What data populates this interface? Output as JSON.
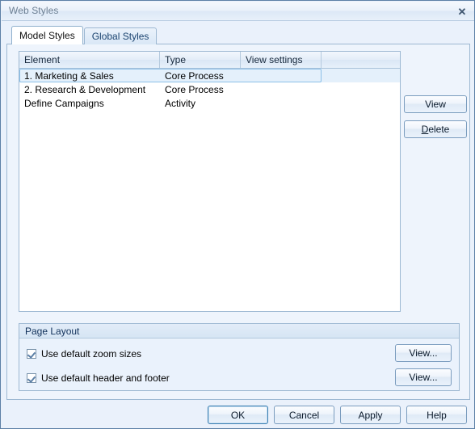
{
  "window": {
    "title": "Web Styles",
    "close_icon": "close-icon",
    "close_glyph": "✕"
  },
  "tabs": [
    {
      "label": "Model Styles",
      "active": true
    },
    {
      "label": "Global Styles",
      "active": false
    }
  ],
  "grid": {
    "columns": [
      "Element",
      "Type",
      "View settings",
      ""
    ],
    "rows": [
      {
        "element": "1. Marketing & Sales",
        "type": "Core Process",
        "view_settings": "",
        "extra": "",
        "selected": true
      },
      {
        "element": "2. Research & Development",
        "type": "Core Process",
        "view_settings": "",
        "extra": "",
        "selected": false
      },
      {
        "element": "Define Campaigns",
        "type": "Activity",
        "view_settings": "",
        "extra": "",
        "selected": false
      }
    ]
  },
  "side_buttons": {
    "view": "View",
    "delete_accel": "D",
    "delete_rest": "elete"
  },
  "page_layout": {
    "title": "Page Layout",
    "options": [
      {
        "label": "Use default zoom sizes",
        "checked": true,
        "button": "View..."
      },
      {
        "label": "Use default header and footer",
        "checked": true,
        "button": "View..."
      }
    ]
  },
  "footer": {
    "ok": "OK",
    "cancel": "Cancel",
    "apply": "Apply",
    "help": "Help"
  },
  "colors": {
    "accent": "#3c7fb1",
    "dialog_bg": "#eaf1fb",
    "border": "#9db8d2",
    "title_text": "#6c7f93",
    "selection": "#e4f0fb"
  }
}
